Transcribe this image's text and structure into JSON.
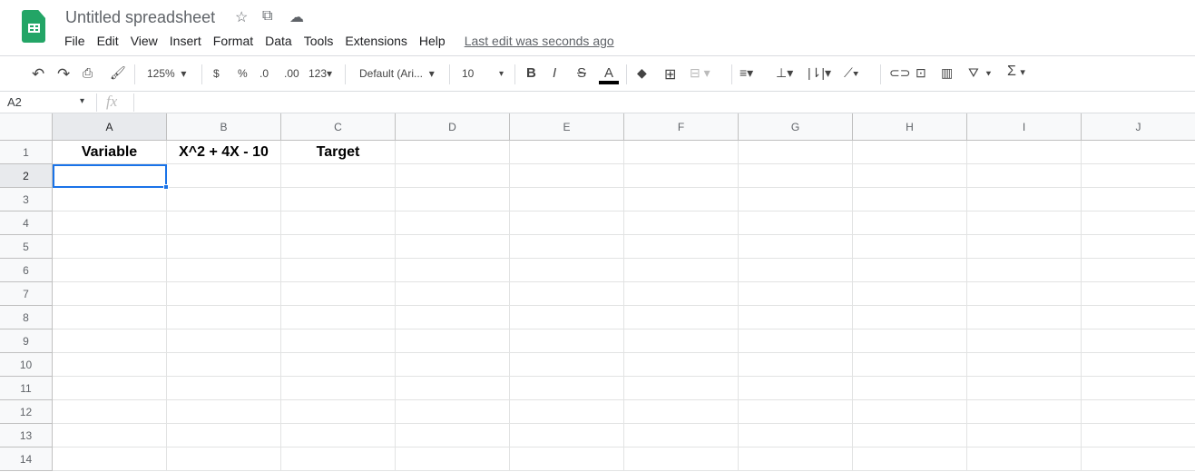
{
  "app": {
    "title": "Untitled spreadsheet",
    "last_edit": "Last edit was seconds ago"
  },
  "menu": [
    "File",
    "Edit",
    "View",
    "Insert",
    "Format",
    "Data",
    "Tools",
    "Extensions",
    "Help"
  ],
  "toolbar": {
    "zoom": "125%",
    "currency": "$",
    "percent": "%",
    "dec_decrease": ".0",
    "dec_increase": ".00",
    "more_formats": "123",
    "font": "Default (Ari...",
    "font_size": "10",
    "bold": "B",
    "italic": "I",
    "strike": "S",
    "text_color": "A",
    "sum": "Σ"
  },
  "formula_bar": {
    "cell_ref": "A2",
    "fx": "fx",
    "value": ""
  },
  "columns": [
    "A",
    "B",
    "C",
    "D",
    "E",
    "F",
    "G",
    "H",
    "I",
    "J"
  ],
  "rows": [
    "1",
    "2",
    "3",
    "4",
    "5",
    "6",
    "7",
    "8",
    "9",
    "10",
    "11",
    "12",
    "13",
    "14"
  ],
  "cells": {
    "A1": "Variable",
    "B1": "X^2 + 4X - 10",
    "C1": "Target"
  },
  "selected": "A2"
}
